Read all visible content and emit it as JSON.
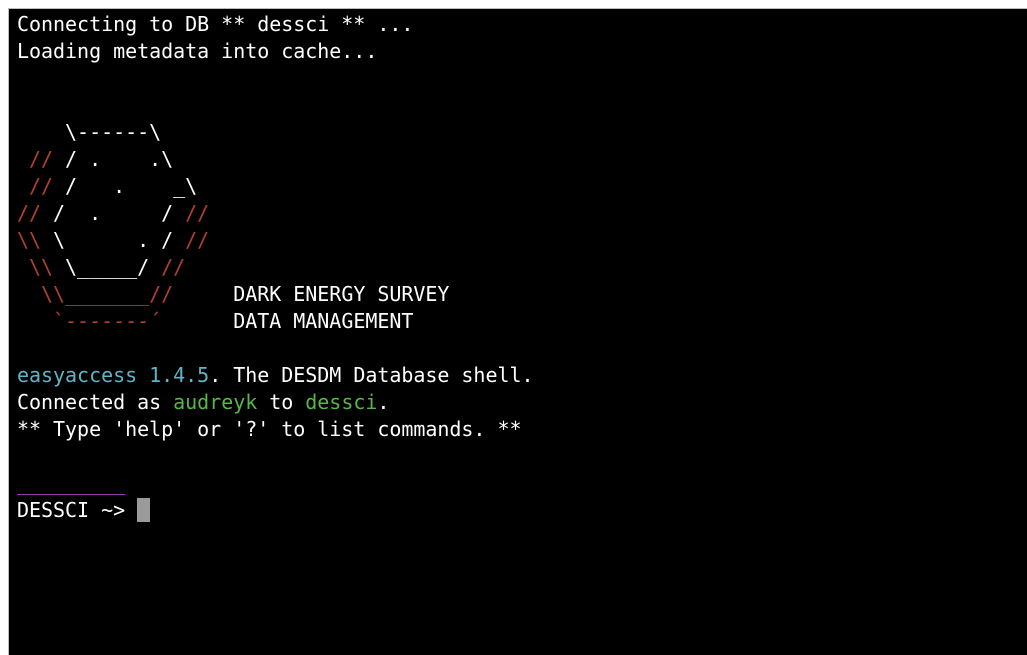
{
  "terminal": {
    "status_lines": [
      "Connecting to DB ** dessci ** ...",
      "Loading metadata into cache..."
    ],
    "logo": {
      "l1": "    \\------\\",
      "l2a": " // ",
      "l2b": "/ .    .\\",
      "l3a": " // ",
      "l3b": "/   .    _\\",
      "l4a": "// ",
      "l4b": "/  .     / ",
      "l4c": "//",
      "l5a": "\\\\ ",
      "l5b": "\\      . / ",
      "l5c": "//",
      "l6a": " \\\\ ",
      "l6b": "\\_____/ ",
      "l6c": "//",
      "l7": "  \\\\_______//",
      "l8": "   `-------´",
      "survey_line1": "DARK ENERGY SURVEY",
      "survey_line2": "DATA MANAGEMENT"
    },
    "banner": {
      "app_name": "easyaccess 1.4.5",
      "tagline": ". The DESDM Database shell.",
      "connected_prefix": "Connected as ",
      "user": "audreyk",
      "connected_mid": " to ",
      "database": "dessci",
      "connected_suffix": ".",
      "help_hint": "** Type 'help' or '?' to list commands. **"
    },
    "separator": "_________",
    "prompt": "DESSCI ~> "
  },
  "colors": {
    "background": "#000000",
    "text": "#ffffff",
    "logo_red": "#b2402e",
    "app_name_cyan": "#5fb4c5",
    "highlight_green": "#57b747",
    "separator_magenta": "#b24fc4",
    "cursor_gray": "#9a9a9a"
  }
}
